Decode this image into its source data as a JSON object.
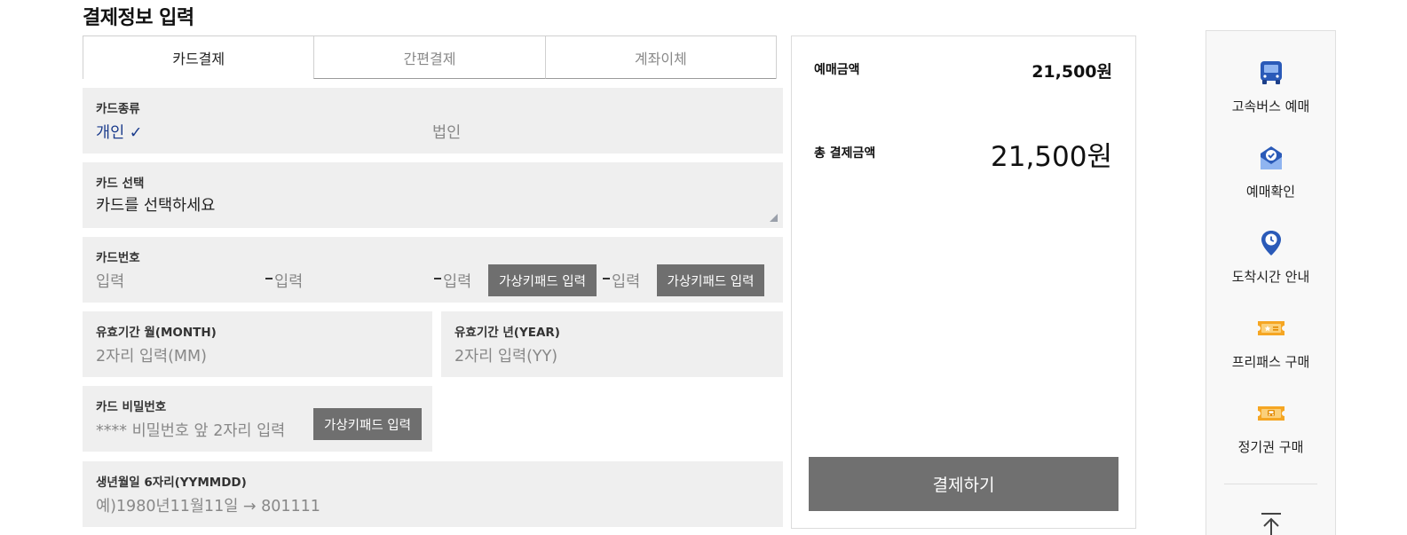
{
  "page": {
    "title": "결제정보 입력"
  },
  "tabs": [
    {
      "label": "카드결제",
      "active": true
    },
    {
      "label": "간편결제",
      "active": false
    },
    {
      "label": "계좌이체",
      "active": false
    }
  ],
  "card_type": {
    "label": "카드종류",
    "options": [
      "개인",
      "법인"
    ],
    "selected": "개인",
    "check": "✓"
  },
  "card_select": {
    "label": "카드 선택",
    "value": "카드를 선택하세요"
  },
  "card_number": {
    "label": "카드번호",
    "field_placeholder": "입력",
    "keypad_button": "가상키패드 입력"
  },
  "expiry_month": {
    "label": "유효기간 월(MONTH)",
    "placeholder": "2자리 입력(MM)"
  },
  "expiry_year": {
    "label": "유효기간 년(YEAR)",
    "placeholder": "2자리 입력(YY)"
  },
  "card_password": {
    "label": "카드 비밀번호",
    "placeholder": "**** 비밀번호 앞 2자리 입력",
    "keypad_button": "가상키패드 입력"
  },
  "birth_date": {
    "label": "생년월일 6자리(YYMMDD)",
    "placeholder": "예)1980년11월11일 → 801111"
  },
  "summary": {
    "reservation_label": "예매금액",
    "reservation_amount": "21,500원",
    "total_label": "총 결제금액",
    "total_amount": "21,500원",
    "pay_button": "결제하기"
  },
  "quick_menu": {
    "items": [
      {
        "label": "고속버스 예매",
        "icon": "bus-icon"
      },
      {
        "label": "예매확인",
        "icon": "ticket-check-icon"
      },
      {
        "label": "도착시간 안내",
        "icon": "location-clock-icon"
      },
      {
        "label": "프리패스 구매",
        "icon": "freepass-ticket-icon"
      },
      {
        "label": "정기권 구매",
        "icon": "season-ticket-icon"
      }
    ],
    "top_icon": "scroll-top-icon"
  },
  "colors": {
    "accent_blue": "#1a3b8c",
    "icon_blue": "#2a5ab8",
    "icon_orange": "#f5a623",
    "button_gray": "#6f6f6f"
  }
}
